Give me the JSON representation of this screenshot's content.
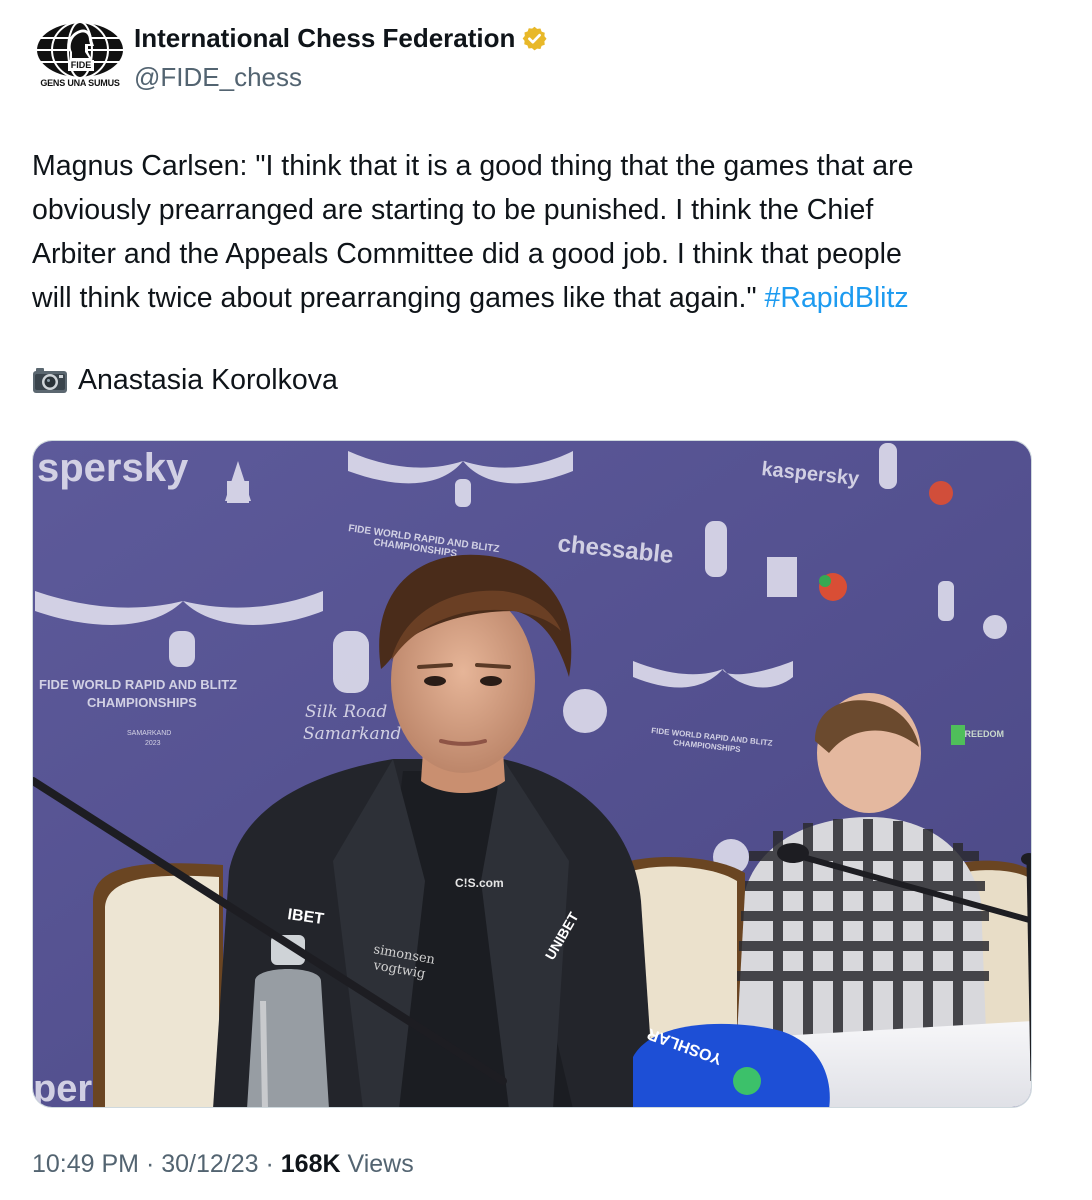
{
  "author": {
    "display_name": "International Chess Federation",
    "handle": "@FIDE_chess",
    "verified_badge": "gold-check",
    "avatar": {
      "logo_text": "FIDE",
      "motto": "GENS UNA SUMUS"
    }
  },
  "tweet": {
    "text": "Magnus Carlsen: \"I think that it is a good thing that the games that are\nobviously prearranged are starting to be punished. I think the Chief\nArbiter and the Appeals Committee did a good job. I think that people\nwill think twice about prearranging games like that again.\" ",
    "hashtag": "#RapidBlitz",
    "photo_credit": "Anastasia Korolkova",
    "photo_credit_icon": "camera-icon"
  },
  "photo": {
    "backdrop_texts": {
      "sponsor_top_left": "spersky",
      "sponsor_top_right": "kaspersky",
      "sponsor_bottom_left": "persk",
      "event_line1": "FIDE WORLD RAPID AND BLITZ",
      "event_line2": "CHAMPIONSHIPS",
      "event_city": "SAMARKAND",
      "event_year": "2023",
      "partner": "chessable",
      "venue_line1": "Silk Road",
      "venue_line2": "Samarkand",
      "small_event_line1": "FIDE WORLD RAPID AND BLITZ",
      "small_event_line2": "CHAMPIONSHIPS",
      "freedom": "FREEDOM"
    },
    "clothing_texts": {
      "chest_logo": "C!S.com",
      "left_sleeve": "IBET",
      "sponsor_patch_line1": "simonsen",
      "sponsor_patch_line2": "vogtwig",
      "right_patch": "UNIBET",
      "microphone": "YOSHLAR"
    },
    "colors": {
      "backdrop": "#5a5796",
      "backdrop_dark": "#47447e",
      "table": "#f3f3f5"
    }
  },
  "meta": {
    "time": "10:49 PM",
    "separator": " · ",
    "date": "30/12/23",
    "views_count": "168K",
    "views_label": " Views"
  }
}
